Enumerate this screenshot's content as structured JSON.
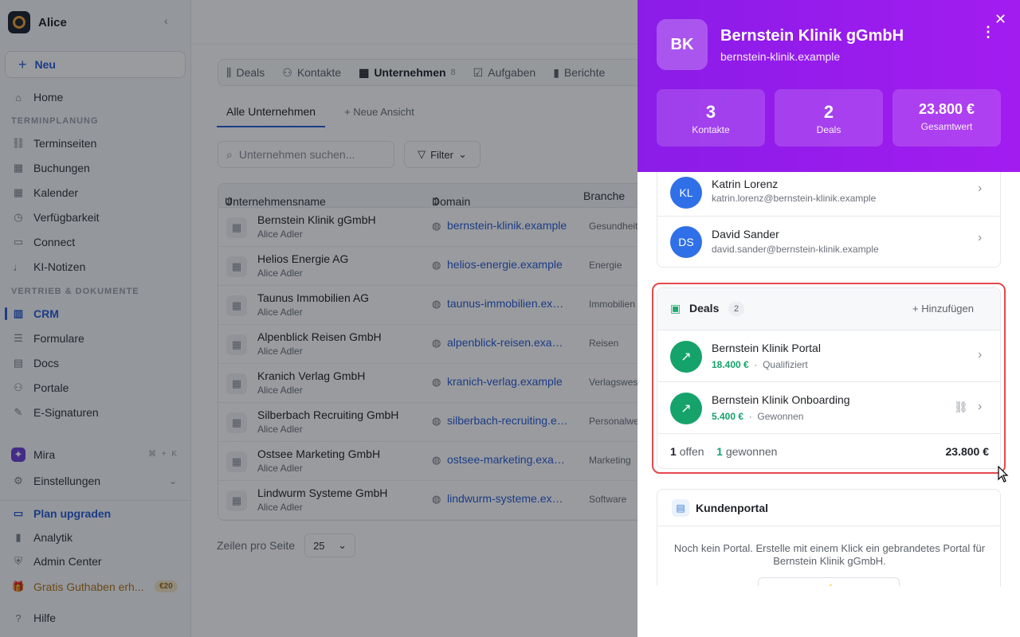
{
  "sidebar": {
    "app_name": "Alice",
    "new_label": "Neu",
    "home": "Home",
    "section1": "TERMINPLANUNG",
    "items1": [
      "Terminseiten",
      "Buchungen",
      "Kalender",
      "Verfügbarkeit",
      "Connect",
      "KI-Notizen"
    ],
    "section2": "VERTRIEB & DOKUMENTE",
    "items2": [
      "CRM",
      "Formulare",
      "Docs",
      "Portale",
      "E-Signaturen"
    ],
    "mira": "Mira",
    "mira_shortcut": "⌘ + K",
    "settings": "Einstellungen",
    "upgrade": "Plan upgraden",
    "analytics": "Analytik",
    "admin": "Admin Center",
    "credit": "Gratis Guthaben erh...",
    "credit_badge": "€20",
    "help": "Hilfe"
  },
  "main": {
    "tabs": [
      {
        "label": "Deals",
        "icon": "deals-icon"
      },
      {
        "label": "Kontakte",
        "icon": "contacts-icon"
      },
      {
        "label": "Unternehmen",
        "count": "8",
        "icon": "building-icon"
      },
      {
        "label": "Aufgaben",
        "icon": "task-icon"
      },
      {
        "label": "Berichte",
        "icon": "chart-icon"
      }
    ],
    "view_all": "Alle Unternehmen",
    "view_new": "Neue Ansicht",
    "search_placeholder": "Unternehmen suchen...",
    "filter_label": "Filter",
    "columns": [
      "Unternehmensname",
      "Domain",
      "Branche"
    ],
    "rows": [
      {
        "name": "Bernstein Klinik gGmbH",
        "owner": "Alice Adler",
        "domain": "bernstein-klinik.example",
        "industry": "Gesundheit"
      },
      {
        "name": "Helios Energie AG",
        "owner": "Alice Adler",
        "domain": "helios-energie.example",
        "industry": "Energie"
      },
      {
        "name": "Taunus Immobilien AG",
        "owner": "Alice Adler",
        "domain": "taunus-immobilien.example",
        "industry": "Immobilien"
      },
      {
        "name": "Alpenblick Reisen GmbH",
        "owner": "Alice Adler",
        "domain": "alpenblick-reisen.example",
        "industry": "Reisen"
      },
      {
        "name": "Kranich Verlag GmbH",
        "owner": "Alice Adler",
        "domain": "kranich-verlag.example",
        "industry": "Verlagswesen"
      },
      {
        "name": "Silberbach Recruiting GmbH",
        "owner": "Alice Adler",
        "domain": "silberbach-recruiting.example",
        "industry": "Personalwesen"
      },
      {
        "name": "Ostsee Marketing GmbH",
        "owner": "Alice Adler",
        "domain": "ostsee-marketing.example",
        "industry": "Marketing"
      },
      {
        "name": "Lindwurm Systeme GmbH",
        "owner": "Alice Adler",
        "domain": "lindwurm-systeme.example",
        "industry": "Software"
      }
    ],
    "rows_per_page_label": "Zeilen pro Seite",
    "rows_per_page": "25"
  },
  "panel": {
    "initials": "BK",
    "name": "Bernstein Klinik gGmbH",
    "domain": "bernstein-klinik.example",
    "stats": [
      {
        "value": "3",
        "label": "Kontakte"
      },
      {
        "value": "2",
        "label": "Deals"
      },
      {
        "value": "23.800 €",
        "label": "Gesamtwert"
      }
    ],
    "contacts": [
      {
        "initials": "KL",
        "name": "Katrin Lorenz",
        "email": "katrin.lorenz@bernstein-klinik.example"
      },
      {
        "initials": "DS",
        "name": "David Sander",
        "email": "david.sander@bernstein-klinik.example"
      }
    ],
    "deals": {
      "title": "Deals",
      "count": "2",
      "add_label": "Hinzufügen",
      "items": [
        {
          "name": "Bernstein Klinik Portal",
          "value": "18.400 €",
          "stage": "Qualifiziert"
        },
        {
          "name": "Bernstein Klinik Onboarding",
          "value": "5.400 €",
          "stage": "Gewonnen"
        }
      ],
      "open_count": "1",
      "open_label": "offen",
      "won_count": "1",
      "won_label": "gewonnen",
      "total": "23.800 €",
      "separator": "·"
    },
    "portal": {
      "title": "Kundenportal",
      "text": "Noch kein Portal. Erstelle mit einem Klick ein gebrandetes Portal für Bernstein Klinik gGmbH."
    }
  },
  "colors": {
    "accent": "#2a5cd6",
    "panel_header": "#9b1cee",
    "deal_green": "#16a36b",
    "highlight": "#e5484d"
  }
}
